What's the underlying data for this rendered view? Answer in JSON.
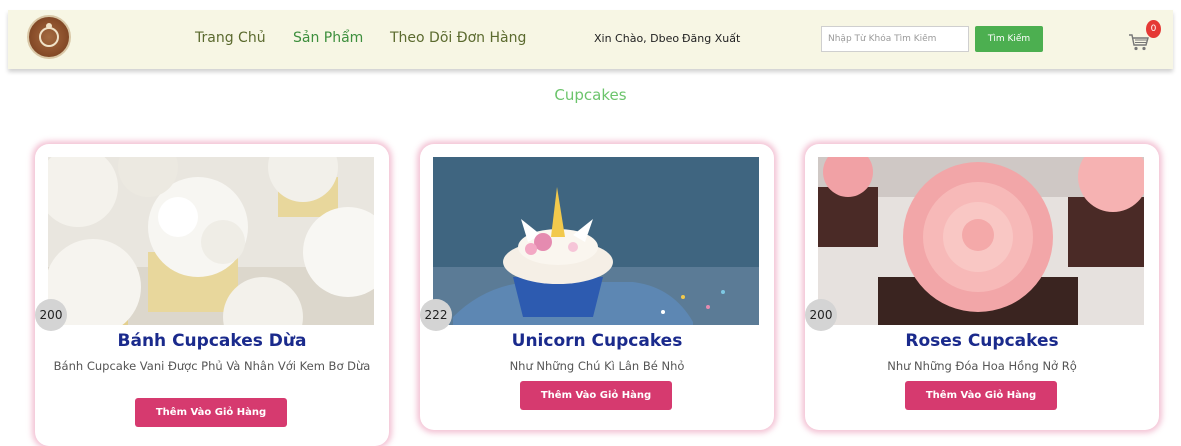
{
  "nav": {
    "home": "Trang Chủ",
    "products": "Sản Phẩm",
    "orders": "Theo Dõi Đơn Hàng",
    "greeting": "Xin Chào, Dbeo",
    "logout": "Đăng Xuất",
    "search_placeholder": "Nhập Từ Khóa Tìm Kiếm",
    "search_button": "Tìm Kiếm",
    "cart_count": "0",
    "icons": [
      "logo-icon",
      "cart-icon"
    ],
    "colors": {
      "navbar_bg": "#f7f6e4",
      "search_button": "#4caf50",
      "cart_badge": "#e53935"
    }
  },
  "section": {
    "title": "Cupcakes",
    "color": "#6cc46c"
  },
  "products": [
    {
      "name": "Bánh Cupcakes Dừa",
      "price": "200",
      "description": "Bánh Cupcake Vani Được Phủ Và Nhân Với Kem Bơ Dừa",
      "button": "Thêm Vào Giỏ Hàng"
    },
    {
      "name": "Unicorn Cupcakes",
      "price": "222",
      "description": "Như Những Chú Kì Lân Bé Nhỏ",
      "button": "Thêm Vào Giỏ Hàng"
    },
    {
      "name": "Roses Cupcakes",
      "price": "200",
      "description": "Như Những Đóa Hoa Hồng Nở Rộ",
      "button": "Thêm Vào Giỏ Hàng"
    }
  ],
  "colors": {
    "title": "#1a2a8c",
    "add_button": "#d63a6f",
    "card_glow": "#e478a0"
  }
}
